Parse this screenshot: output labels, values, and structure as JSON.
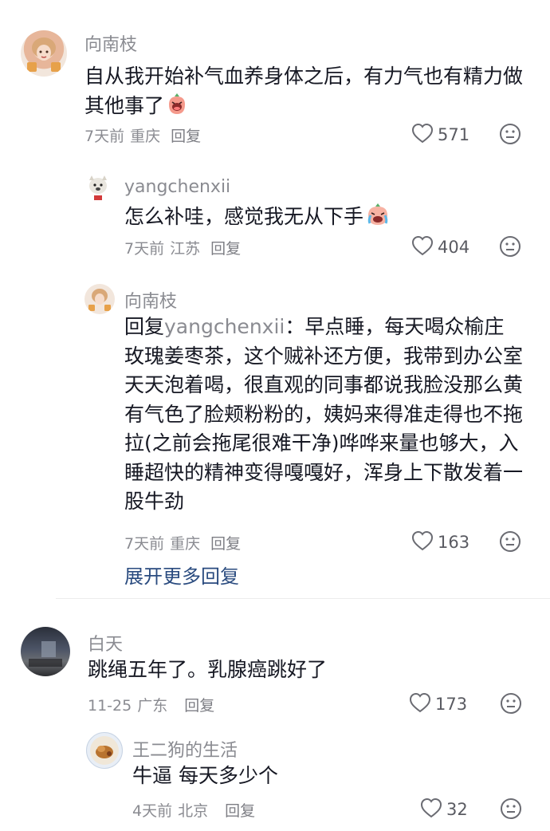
{
  "comments": [
    {
      "user": "向南枝",
      "text": "自从我开始补气血养身体之后，有力气也有精力做其他事了",
      "time": "7天前",
      "location": "重庆",
      "reply_label": "回复",
      "likes": "571",
      "replies": [
        {
          "user": "yangchenxii",
          "text": "怎么补哇，感觉我无从下手",
          "time": "7天前",
          "location": "江苏",
          "reply_label": "回复",
          "likes": "404"
        },
        {
          "user": "向南枝",
          "reply_prefix": "回复",
          "mention": "yangchenxii",
          "text": "：早点睡，每天喝众榆庄玫瑰姜枣茶，这个贼补还方便，我带到办公室天天泡着喝，很直观的同事都说我脸没那么黄有气色了脸颊粉粉的，姨妈来得准走得也不拖拉(之前会拖尾很难干净)哗哗来量也够大，入睡超快的精神变得嘎嘎好，浑身上下散发着一股牛劲",
          "time": "7天前",
          "location": "重庆",
          "reply_label": "回复",
          "likes": "163"
        }
      ],
      "expand_label": "展开更多回复"
    },
    {
      "user": "白天",
      "text": "跳绳五年了。乳腺癌跳好了",
      "time": "11-25",
      "location": "广东",
      "reply_label": "回复",
      "likes": "173",
      "replies": [
        {
          "user": "王二狗的生活",
          "text": "牛逼 每天多少个",
          "time": "4天前",
          "location": "北京",
          "reply_label": "回复",
          "likes": "32"
        }
      ]
    }
  ],
  "icons": {
    "like": "heart-outline-icon",
    "dislike": "neutral-face-icon"
  },
  "colors": {
    "text": "#161823",
    "muted": "#8a8b91",
    "expand_link": "#2a4b7f"
  }
}
